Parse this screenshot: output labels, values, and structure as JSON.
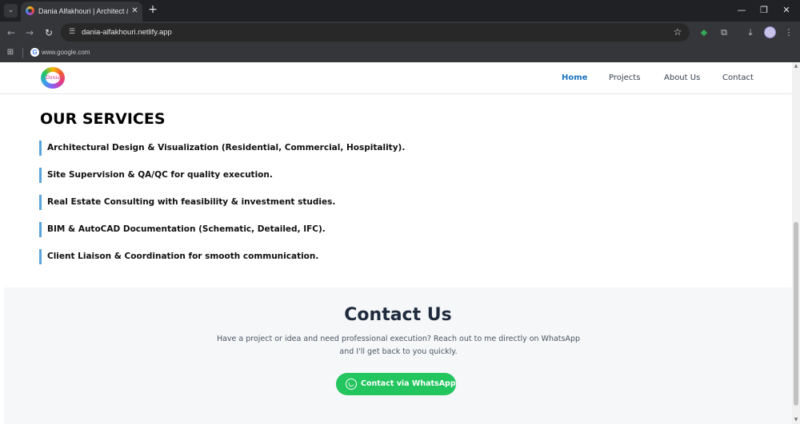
{
  "browser": {
    "tab": {
      "title": "Dania Alfakhouri | Architect & I",
      "close_glyph": "✕",
      "list_glyph": "⌄",
      "favicon": "site-favicon-icon"
    },
    "new_tab_glyph": "+",
    "window_controls": {
      "minimize": "—",
      "restore": "❐",
      "close": "✕"
    },
    "toolbar": {
      "back": "←",
      "forward": "→",
      "reload": "↻",
      "site_info": "☰",
      "url": "dania-alfakhouri.netlify.app",
      "star": "☆",
      "extension": "◆",
      "puzzle": "⧉",
      "download": "⤓",
      "menu": "⋮"
    },
    "bookmarks": {
      "apps_glyph": "⊞",
      "google_glyph": "G",
      "google_label": "www.google.com"
    }
  },
  "site": {
    "logo_text": "Dania",
    "nav": {
      "home": "Home",
      "projects": "Projects",
      "about": "About Us",
      "contact": "Contact"
    },
    "services": {
      "title": "OUR SERVICES",
      "items": [
        "Architectural Design & Visualization (Residential, Commercial, Hospitality).",
        "Site Supervision & QA/QC for quality execution.",
        "Real Estate Consulting with feasibility & investment studies.",
        "BIM & AutoCAD Documentation (Schematic, Detailed, IFC).",
        "Client Liaison & Coordination for smooth communication."
      ]
    },
    "contact": {
      "title": "Contact Us",
      "text_line1": "Have a project or idea and need professional execution? Reach out to me directly on WhatsApp",
      "text_line2": "and I'll get back to you quickly.",
      "button_label": "Contact via WhatsApp"
    },
    "scroll": {
      "up": "▲",
      "down": "▼"
    }
  },
  "colors": {
    "accent": "#1e73be",
    "service_bar": "#5ba4d9",
    "whatsapp": "#22c55e",
    "contact_bg": "#f5f7f9",
    "heading": "#1f2b3d"
  }
}
